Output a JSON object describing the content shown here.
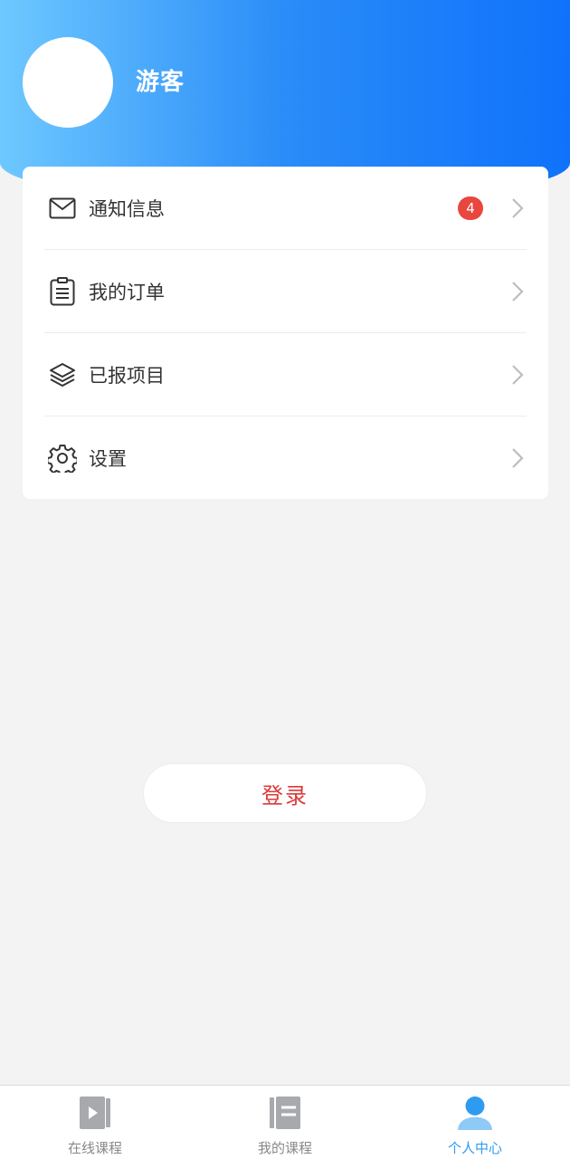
{
  "profile": {
    "name": "游客"
  },
  "menu": {
    "items": [
      {
        "label": "通知信息",
        "icon": "mail-icon",
        "badge": "4"
      },
      {
        "label": "我的订单",
        "icon": "clipboard-icon"
      },
      {
        "label": "已报项目",
        "icon": "layers-icon"
      },
      {
        "label": "设置",
        "icon": "gear-icon"
      }
    ]
  },
  "login": {
    "label": "登录"
  },
  "tabbar": {
    "tabs": [
      {
        "label": "在线课程",
        "icon": "video-book-icon",
        "active": false
      },
      {
        "label": "我的课程",
        "icon": "notebook-icon",
        "active": false
      },
      {
        "label": "个人中心",
        "icon": "person-icon",
        "active": true
      }
    ]
  },
  "colors": {
    "header_start": "#6ec8ff",
    "header_end": "#0f72fb",
    "badge": "#e8473f",
    "login_text": "#dc3a3a",
    "tab_active": "#2f9bf0",
    "tab_inactive": "#888888"
  }
}
